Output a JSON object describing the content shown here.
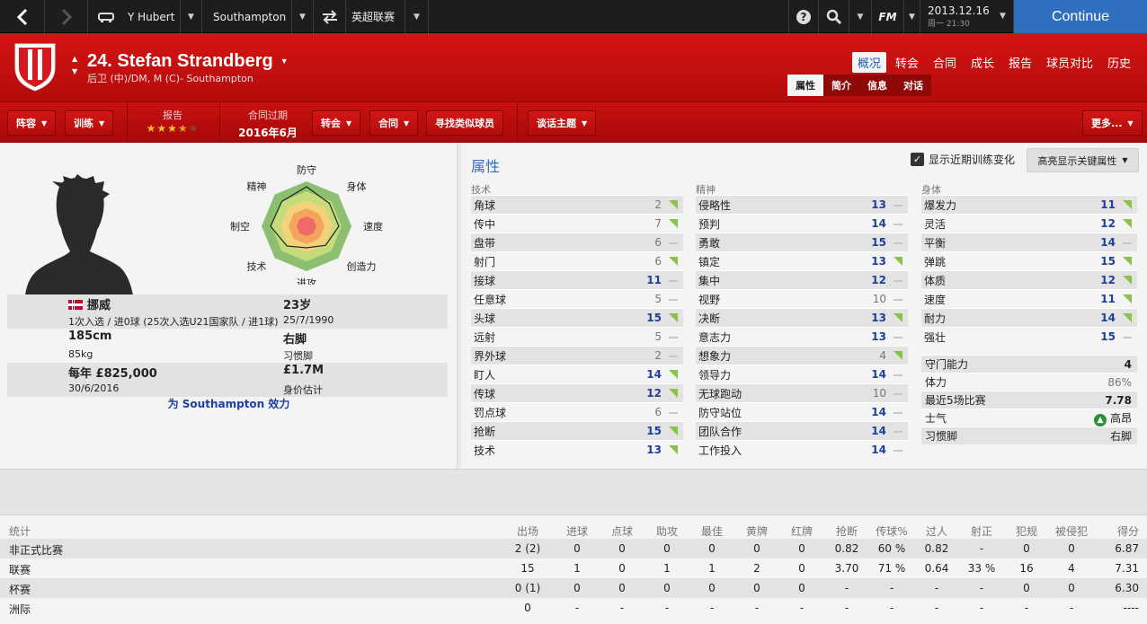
{
  "topbar": {
    "manager": "Y Hubert",
    "club": "Southampton",
    "competition": "英超联赛",
    "fm_label": "FM",
    "date": "2013.12.16",
    "time": "周一 21:30",
    "continue_label": "Continue"
  },
  "player": {
    "name": "24. Stefan Strandberg",
    "position": "后卫 (中)/DM, M (C)- Southampton"
  },
  "tabs": [
    "概况",
    "转会",
    "合同",
    "成长",
    "报告",
    "球员对比",
    "历史"
  ],
  "subtabs": [
    "属性",
    "简介",
    "信息",
    "对话"
  ],
  "toolbar": {
    "squad": "阵容",
    "training": "训练",
    "report_label": "报告",
    "report_stars": "★★★",
    "report_half": "★",
    "report_empty": "★",
    "report_rating": 3.5,
    "contract_label": "合同过期",
    "contract_value": "2016年6月",
    "transfer": "转会",
    "contract": "合同",
    "similar": "寻找类似球员",
    "talk": "谈话主题",
    "more": "更多..."
  },
  "radar": {
    "labels": [
      "防守",
      "身体",
      "速度",
      "创造力",
      "进攻",
      "技术",
      "制空",
      "精神"
    ],
    "values": [
      0.88,
      0.72,
      0.72,
      0.6,
      0.48,
      0.62,
      0.8,
      0.78
    ]
  },
  "info": {
    "nationality": "挪威",
    "caps": "1次入选 / 进0球 (25次入选U21国家队 / 进1球)",
    "age": "23岁",
    "dob": "25/7/1990",
    "height": "185cm",
    "weight": "85kg",
    "foot": "右脚",
    "foot_label": "习惯脚",
    "wage": "每年 £825,000",
    "wage_expiry": "30/6/2016",
    "value": "£1.7M",
    "value_label": "身价估计",
    "plays_for": "为 Southampton 效力"
  },
  "attributes": {
    "title": "属性",
    "show_training": "显示近期训练变化",
    "show_training_checked": true,
    "highlight": "高亮显示关键属性",
    "technical": {
      "header": "技术",
      "rows": [
        {
          "name": "角球",
          "value": "2",
          "trend": "up"
        },
        {
          "name": "传中",
          "value": "7",
          "trend": "up"
        },
        {
          "name": "盘带",
          "value": "6",
          "trend": "flat"
        },
        {
          "name": "射门",
          "value": "6",
          "trend": "up"
        },
        {
          "name": "接球",
          "value": "11",
          "trend": "flat"
        },
        {
          "name": "任意球",
          "value": "5",
          "trend": "flat"
        },
        {
          "name": "头球",
          "value": "15",
          "trend": "up"
        },
        {
          "name": "远射",
          "value": "5",
          "trend": "flat"
        },
        {
          "name": "界外球",
          "value": "2",
          "trend": "flat"
        },
        {
          "name": "盯人",
          "value": "14",
          "trend": "up"
        },
        {
          "name": "传球",
          "value": "12",
          "trend": "up"
        },
        {
          "name": "罚点球",
          "value": "6",
          "trend": "flat"
        },
        {
          "name": "抢断",
          "value": "15",
          "trend": "up"
        },
        {
          "name": "技术",
          "value": "13",
          "trend": "up"
        }
      ]
    },
    "mental": {
      "header": "精神",
      "rows": [
        {
          "name": "侵略性",
          "value": "13",
          "trend": "flat"
        },
        {
          "name": "预判",
          "value": "14",
          "trend": "flat"
        },
        {
          "name": "勇敢",
          "value": "15",
          "trend": "flat"
        },
        {
          "name": "镇定",
          "value": "13",
          "trend": "up"
        },
        {
          "name": "集中",
          "value": "12",
          "trend": "flat"
        },
        {
          "name": "视野",
          "value": "10",
          "trend": "flat"
        },
        {
          "name": "决断",
          "value": "13",
          "trend": "up"
        },
        {
          "name": "意志力",
          "value": "13",
          "trend": "flat"
        },
        {
          "name": "想象力",
          "value": "4",
          "trend": "up"
        },
        {
          "name": "领导力",
          "value": "14",
          "trend": "flat"
        },
        {
          "name": "无球跑动",
          "value": "10",
          "trend": "flat"
        },
        {
          "name": "防守站位",
          "value": "14",
          "trend": "flat"
        },
        {
          "name": "团队合作",
          "value": "14",
          "trend": "flat"
        },
        {
          "name": "工作投入",
          "value": "14",
          "trend": "flat"
        }
      ]
    },
    "physical": {
      "header": "身体",
      "rows": [
        {
          "name": "爆发力",
          "value": "11",
          "trend": "up"
        },
        {
          "name": "灵活",
          "value": "12",
          "trend": "up"
        },
        {
          "name": "平衡",
          "value": "14",
          "trend": "flat"
        },
        {
          "name": "弹跳",
          "value": "15",
          "trend": "up"
        },
        {
          "name": "体质",
          "value": "12",
          "trend": "up"
        },
        {
          "name": "速度",
          "value": "11",
          "trend": "up"
        },
        {
          "name": "耐力",
          "value": "14",
          "trend": "up"
        },
        {
          "name": "强壮",
          "value": "15",
          "trend": "flat"
        }
      ]
    },
    "extra": [
      {
        "name": "守门能力",
        "value": "4"
      },
      {
        "name": "体力",
        "value": "86%"
      },
      {
        "name": "最近5场比赛",
        "value": "7.78"
      },
      {
        "name": "士气",
        "value": "高昂"
      },
      {
        "name": "习惯脚",
        "value": "右脚"
      }
    ]
  },
  "stats": {
    "headers": [
      "统计",
      "出场",
      "进球",
      "点球",
      "助攻",
      "最佳",
      "黄牌",
      "红牌",
      "抢断",
      "传球%",
      "过人",
      "射正",
      "犯规",
      "被侵犯",
      "得分"
    ],
    "rows": [
      [
        "非正式比赛",
        "2 (2)",
        "0",
        "0",
        "0",
        "0",
        "0",
        "0",
        "0.82",
        "60 %",
        "0.82",
        "-",
        "0",
        "0",
        "6.87"
      ],
      [
        "联赛",
        "15",
        "1",
        "0",
        "1",
        "1",
        "2",
        "0",
        "3.70",
        "71 %",
        "0.64",
        "33 %",
        "16",
        "4",
        "7.31"
      ],
      [
        "杯赛",
        "0 (1)",
        "0",
        "0",
        "0",
        "0",
        "0",
        "0",
        "-",
        "-",
        "-",
        "-",
        "0",
        "0",
        "6.30"
      ],
      [
        "洲际",
        "0",
        "-",
        "-",
        "-",
        "-",
        "-",
        "-",
        "-",
        "-",
        "-",
        "-",
        "-",
        "-",
        "----"
      ]
    ]
  }
}
